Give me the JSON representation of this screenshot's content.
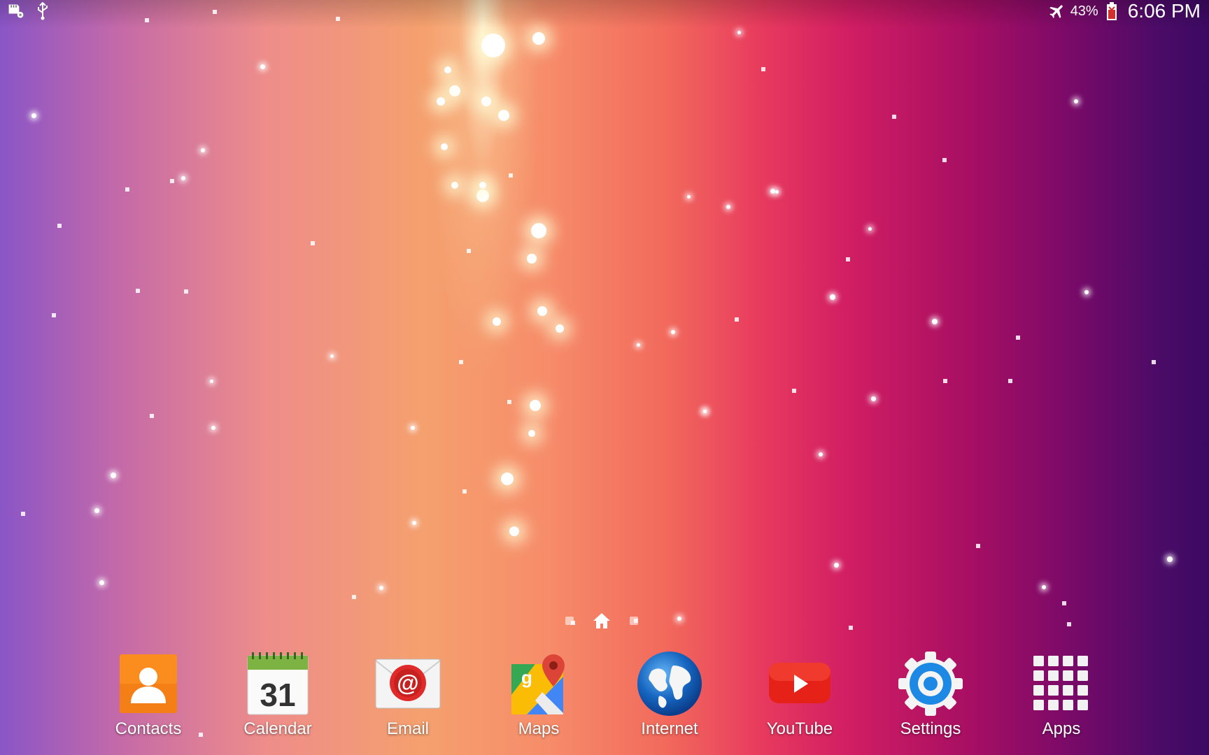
{
  "status_bar": {
    "battery_percent": "43%",
    "time": "6:06 PM",
    "left_icons": [
      "sd-card-settings-icon",
      "usb-icon"
    ],
    "right_icons": [
      "airplane-mode-icon",
      "battery-icon"
    ]
  },
  "home_screen": {
    "page_indicator": [
      "page-dot",
      "home-page",
      "page-dot"
    ],
    "current_page": "home"
  },
  "dock": {
    "apps": [
      {
        "label": "Contacts",
        "icon": "contacts-icon"
      },
      {
        "label": "Calendar",
        "icon": "calendar-icon",
        "calendar_day": "31"
      },
      {
        "label": "Email",
        "icon": "email-icon"
      },
      {
        "label": "Maps",
        "icon": "maps-icon"
      },
      {
        "label": "Internet",
        "icon": "internet-globe-icon"
      },
      {
        "label": "YouTube",
        "icon": "youtube-icon"
      },
      {
        "label": "Settings",
        "icon": "settings-gear-icon"
      },
      {
        "label": "Apps",
        "icon": "apps-grid-icon"
      }
    ]
  },
  "colors": {
    "contacts_orange": "#f57f17",
    "calendar_green": "#7cb342",
    "email_red": "#e02a2a",
    "youtube_red": "#e62117",
    "settings_blue": "#1e88e5",
    "globe_blue": "#1565c0"
  }
}
